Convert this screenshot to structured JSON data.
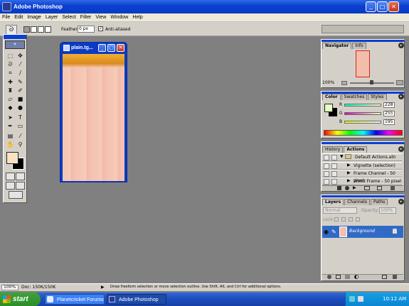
{
  "app": {
    "title": "Adobe Photoshop"
  },
  "window_controls": {
    "minimize": "_",
    "maximize": "□",
    "close": "✕"
  },
  "menu": [
    "File",
    "Edit",
    "Image",
    "Layer",
    "Select",
    "Filter",
    "View",
    "Window",
    "Help"
  ],
  "options": {
    "feather_label": "Feather:",
    "feather_value": "0 px",
    "antialiased_label": "Anti-aliased",
    "antialiased_check": "✓"
  },
  "document": {
    "title": "plain.tg..."
  },
  "navigator": {
    "tabs": [
      "Navigator",
      "Info"
    ],
    "zoom": "100%"
  },
  "color": {
    "tabs": [
      "Color",
      "Swatches",
      "Styles"
    ],
    "channels": [
      {
        "label": "R",
        "value": "228"
      },
      {
        "label": "G",
        "value": "255"
      },
      {
        "label": "B",
        "value": "195"
      }
    ]
  },
  "actions": {
    "tabs": [
      "History",
      "Actions"
    ],
    "items": [
      "Default Actions.atn",
      "Vignette (selection)",
      "Frame Channel - 50 pixel",
      "Wood Frame - 50 pixel"
    ]
  },
  "layers": {
    "tabs": [
      "Layers",
      "Channels",
      "Paths"
    ],
    "blend_mode": "Normal",
    "opacity_label": "Opacity:",
    "opacity_value": "100%",
    "lock_label": "Lock:",
    "layer_name": "Background"
  },
  "status": {
    "zoom": "100%",
    "doc": "Doc: 150K/150K",
    "hint": "Draw freeform selection or move selection outline. Use Shift, Alt, and Ctrl for additional options."
  },
  "taskbar": {
    "start": "start",
    "tasks": [
      "Planetcricket Forums ...",
      "Adobe Photoshop"
    ],
    "time": "10:12 AM"
  },
  "colors": {
    "title_blue": "#0a3fcf",
    "selection_blue": "#316ac5",
    "canvas_peach": "#f5c3b2",
    "taskbar_blue": "#1f4fc4"
  }
}
